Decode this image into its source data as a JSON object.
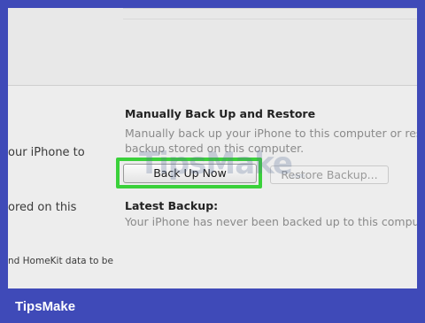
{
  "left_column": {
    "line1": "our iPhone to",
    "line2": "ored on this",
    "line3": "nd HomeKit data to be"
  },
  "backup_section": {
    "title": "Manually Back Up and Restore",
    "desc_line1": "Manually back up your iPhone to this computer or resto",
    "desc_line2": "backup stored on this computer.",
    "back_up_now_label": "Back Up Now",
    "restore_backup_label": "Restore Backup..."
  },
  "latest_backup": {
    "title": "Latest Backup:",
    "status": "Your iPhone has never been backed up to this computer"
  },
  "watermark": {
    "text": "TipsMake",
    "small": ".com"
  },
  "footer": {
    "brand": "TipsMake"
  },
  "colors": {
    "frame_border": "#3f4ab8",
    "highlight": "#3ad13a"
  }
}
